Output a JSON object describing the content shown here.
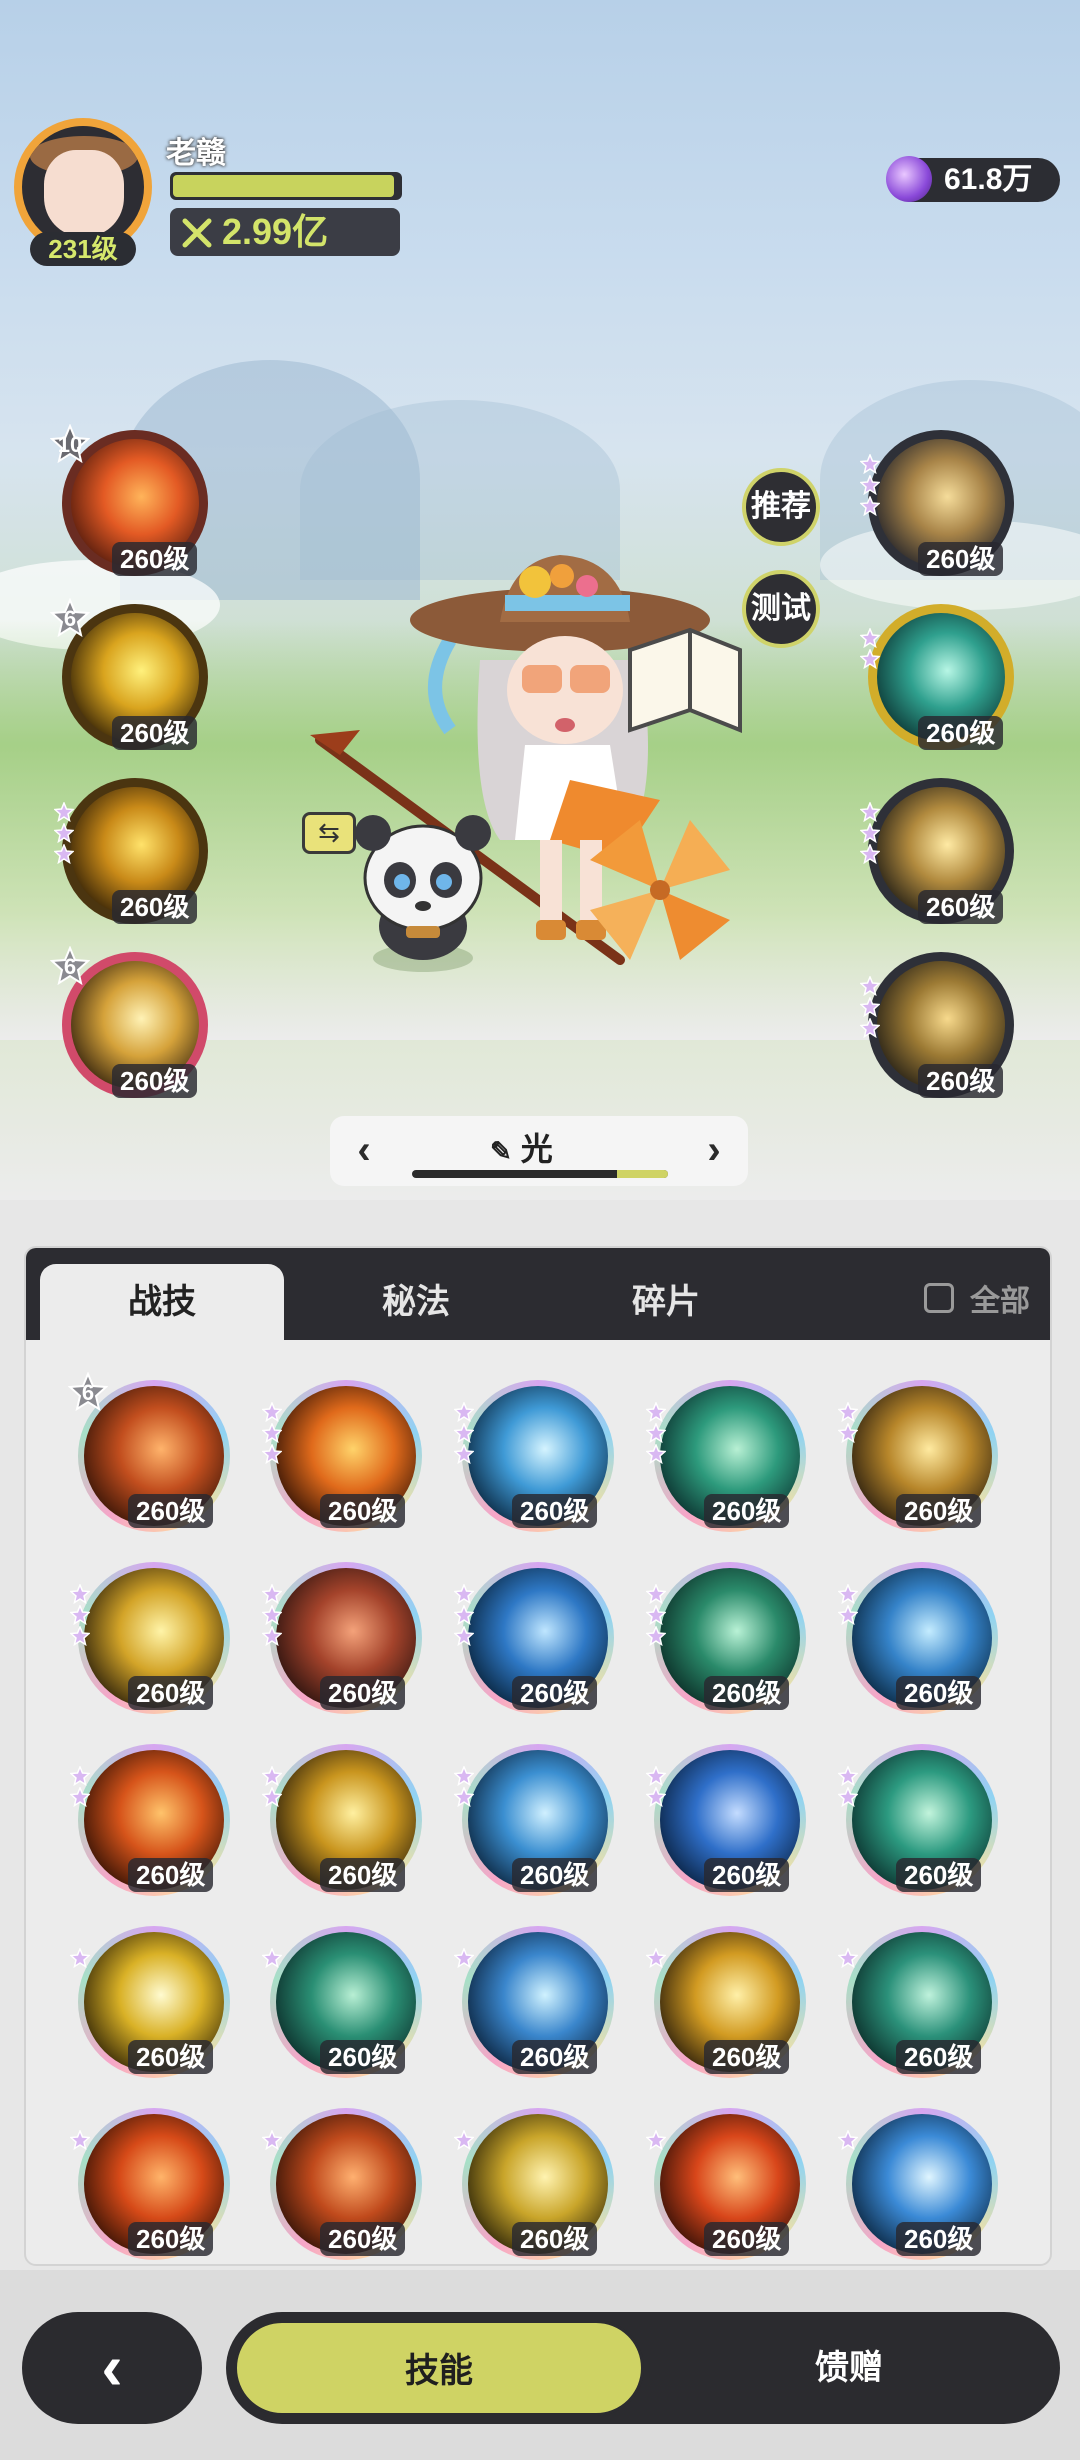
{
  "player": {
    "name": "老赣",
    "level": "231级",
    "hp_ratio": 0.98,
    "power": "2.99亿"
  },
  "currency": {
    "icon": "purple-gem-icon",
    "amount": "61.8万"
  },
  "side_buttons": {
    "recommend": "推荐",
    "test": "测试"
  },
  "equipped": {
    "left": [
      {
        "level": "260级",
        "stars": "10",
        "icon": "explosion-fire-icon",
        "colors": [
          "#5a1e0e",
          "#e35a24",
          "#ffb45a"
        ],
        "ring": "#6a2c22"
      },
      {
        "level": "260级",
        "stars": "6",
        "icon": "lightning-orb-icon",
        "colors": [
          "#3e2a08",
          "#d9a41e",
          "#fff17c"
        ],
        "ring": "#4b3510"
      },
      {
        "level": "260级",
        "stars": "",
        "icon": "thunder-strike-icon",
        "colors": [
          "#3a2608",
          "#c98a18",
          "#ffe26a"
        ],
        "ring": "#4b3510"
      },
      {
        "level": "260级",
        "stars": "6",
        "icon": "holy-star-icon",
        "colors": [
          "#3d2a10",
          "#d5a23a",
          "#fff2b5"
        ],
        "ring": "#d14a6a"
      }
    ],
    "right": [
      {
        "level": "260级",
        "stars": "",
        "icon": "golden-sword-icon",
        "colors": [
          "#2c2a2c",
          "#a88448",
          "#f5dc9a"
        ],
        "ring": "#2e3038"
      },
      {
        "level": "260级",
        "stars": "",
        "icon": "jade-rune-icon",
        "colors": [
          "#0e3b38",
          "#2fa08e",
          "#b7f6e5"
        ],
        "ring": "#d2ad2a"
      },
      {
        "level": "260级",
        "stars": "",
        "icon": "light-keyhole-icon",
        "colors": [
          "#2b2518",
          "#b18a3e",
          "#ffeaa4"
        ],
        "ring": "#2e3038"
      },
      {
        "level": "260级",
        "stars": "",
        "icon": "light-halo-icon",
        "colors": [
          "#2a2418",
          "#9c7a34",
          "#f7d98c"
        ],
        "ring": "#2e3038"
      }
    ]
  },
  "element_switcher": {
    "label": "光",
    "progress": 0.2
  },
  "tabs": [
    {
      "label": "战技"
    },
    {
      "label": "秘法"
    },
    {
      "label": "碎片"
    }
  ],
  "filter_all": "全部",
  "skills": [
    {
      "level": "260级",
      "badge": "6",
      "icon": "fire-vortex-icon",
      "colors": [
        "#3b1608",
        "#c24e1e",
        "#ffb36b"
      ]
    },
    {
      "level": "260级",
      "badge": "",
      "icon": "flame-burst-icon",
      "colors": [
        "#3a1606",
        "#e06a1b",
        "#ffd36a"
      ]
    },
    {
      "level": "260级",
      "badge": "",
      "icon": "ice-crystal-icon",
      "colors": [
        "#0c2b45",
        "#3f9ad6",
        "#d5f4ff"
      ]
    },
    {
      "level": "260级",
      "badge": "",
      "icon": "wind-swirl-icon",
      "colors": [
        "#0c3330",
        "#2d9a7c",
        "#b8f0d4"
      ]
    },
    {
      "level": "260级",
      "badge": "",
      "icon": "star-sparks-icon",
      "colors": [
        "#2f2210",
        "#b7862a",
        "#ffeaa0"
      ]
    },
    {
      "level": "260级",
      "badge": "",
      "icon": "light-beam-icon",
      "colors": [
        "#33260c",
        "#d3a428",
        "#fff4a8"
      ]
    },
    {
      "level": "260级",
      "badge": "",
      "icon": "meteor-fire-icon",
      "colors": [
        "#2e1410",
        "#a4432b",
        "#f4a27a"
      ]
    },
    {
      "level": "260级",
      "badge": "",
      "icon": "water-wave-icon",
      "colors": [
        "#0a2640",
        "#2e78c5",
        "#bfe6ff"
      ]
    },
    {
      "level": "260级",
      "badge": "",
      "icon": "green-orb-icon",
      "colors": [
        "#0c2f28",
        "#2a8a6a",
        "#b9f2d6"
      ]
    },
    {
      "level": "260级",
      "badge": "",
      "icon": "water-spiral-icon",
      "colors": [
        "#0b2a44",
        "#3583c9",
        "#c4ecff"
      ]
    },
    {
      "level": "260级",
      "badge": "",
      "icon": "fire-blast-icon",
      "colors": [
        "#3a1406",
        "#d6541a",
        "#ffc36b"
      ]
    },
    {
      "level": "260级",
      "badge": "",
      "icon": "light-flash-icon",
      "colors": [
        "#33250c",
        "#c9951e",
        "#fff0a0"
      ]
    },
    {
      "level": "260级",
      "badge": "",
      "icon": "ice-shatter-icon",
      "colors": [
        "#0e2a45",
        "#3b8fd1",
        "#d0f0ff"
      ]
    },
    {
      "level": "260级",
      "badge": "",
      "icon": "water-orb-icon",
      "colors": [
        "#0b2445",
        "#2f6fc9",
        "#c4dcff"
      ]
    },
    {
      "level": "260级",
      "badge": "",
      "icon": "wind-arrow-icon",
      "colors": [
        "#0c3430",
        "#2c9a80",
        "#c2f4dc"
      ]
    },
    {
      "level": "260级",
      "badge": "",
      "icon": "sun-burst-icon",
      "colors": [
        "#3a2c08",
        "#d9b126",
        "#fffbd0"
      ]
    },
    {
      "level": "260级",
      "badge": "",
      "icon": "wind-vortex-icon",
      "colors": [
        "#0d302c",
        "#2a8f74",
        "#b8efd4"
      ]
    },
    {
      "level": "260级",
      "badge": "",
      "icon": "ice-spikes-icon",
      "colors": [
        "#0d2743",
        "#3a86cc",
        "#d0f2ff"
      ]
    },
    {
      "level": "260级",
      "badge": "",
      "icon": "golden-slash-icon",
      "colors": [
        "#33240c",
        "#d29b22",
        "#fff0a8"
      ]
    },
    {
      "level": "260级",
      "badge": "",
      "icon": "thorn-vine-icon",
      "colors": [
        "#0c302b",
        "#2b917a",
        "#bff2dc"
      ]
    },
    {
      "level": "260级",
      "badge": "",
      "icon": "fire-pillar-icon",
      "colors": [
        "#3b1406",
        "#d64a18",
        "#ffb46a"
      ]
    },
    {
      "level": "260级",
      "badge": "",
      "icon": "fire-swirl-icon",
      "colors": [
        "#361408",
        "#c04a1c",
        "#ffb070"
      ]
    },
    {
      "level": "260级",
      "badge": "",
      "icon": "gold-crystal-icon",
      "colors": [
        "#332a0a",
        "#c9a52a",
        "#fff3b0"
      ]
    },
    {
      "level": "260级",
      "badge": "",
      "icon": "fireball-icon",
      "colors": [
        "#3a1208",
        "#d8461a",
        "#ffbe7a"
      ]
    },
    {
      "level": "260级",
      "badge": "",
      "icon": "ice-flower-icon",
      "colors": [
        "#0d2a46",
        "#3b8ad6",
        "#dff5ff"
      ]
    }
  ],
  "bottom_nav": {
    "back_icon": "chevron-left-icon",
    "skills": "技能",
    "gift": "馈赠"
  }
}
